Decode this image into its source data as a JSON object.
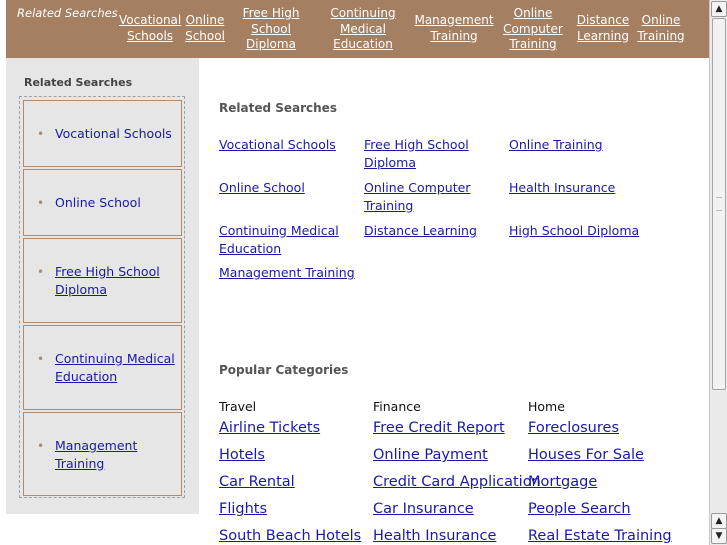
{
  "topbar": {
    "related_label": "Related Searches",
    "links": [
      "Vocational Schools",
      "Online School",
      "Free High School Diploma",
      "Continuing Medical Education",
      "Management Training",
      "Online Computer Training",
      "Distance Learning",
      "Online Training"
    ]
  },
  "sidebar": {
    "title": "Related Searches",
    "items": [
      "Vocational Schools",
      "Online School",
      "Free High School Diploma",
      "Continuing Medical Education",
      "Management Training"
    ]
  },
  "main": {
    "related_heading": "Related Searches",
    "related_links": [
      "Vocational Schools",
      "Free High School Diploma",
      "Online Training",
      "Online School",
      "Online Computer Training",
      "Health Insurance",
      "Continuing Medical Education",
      "Distance Learning",
      "High School Diploma",
      "Management Training"
    ],
    "popular_heading": "Popular Categories",
    "categories": [
      {
        "name": "Travel",
        "links": [
          "Airline Tickets",
          "Hotels",
          "Car Rental",
          "Flights",
          "South Beach Hotels"
        ]
      },
      {
        "name": "Finance",
        "links": [
          "Free Credit Report",
          "Online Payment",
          "Credit Card Application",
          "Car Insurance",
          "Health Insurance"
        ]
      },
      {
        "name": "Home",
        "links": [
          "Foreclosures",
          "Houses For Sale",
          "Mortgage",
          "People Search",
          "Real Estate Training"
        ]
      }
    ]
  },
  "scrollbar": {
    "up_icon": "arrow-up-icon",
    "down_icon": "arrow-down-icon"
  }
}
